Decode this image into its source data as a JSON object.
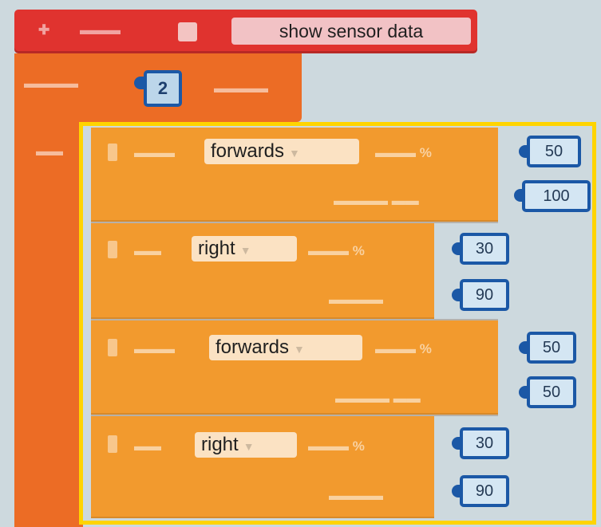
{
  "start_block": {
    "label": "show sensor data"
  },
  "repeat": {
    "count": "2"
  },
  "blocks": [
    {
      "direction": "forwards",
      "speed": "50",
      "amount": "100"
    },
    {
      "direction": "right",
      "speed": "30",
      "amount": "90"
    },
    {
      "direction": "forwards",
      "speed": "50",
      "amount": "50"
    },
    {
      "direction": "right",
      "speed": "30",
      "amount": "90"
    }
  ],
  "colors": {
    "start": "#e0332f",
    "loop": "#ec6c25",
    "motion": "#f29a2e",
    "value_border": "#1b58a6",
    "selection": "#ffd400"
  }
}
